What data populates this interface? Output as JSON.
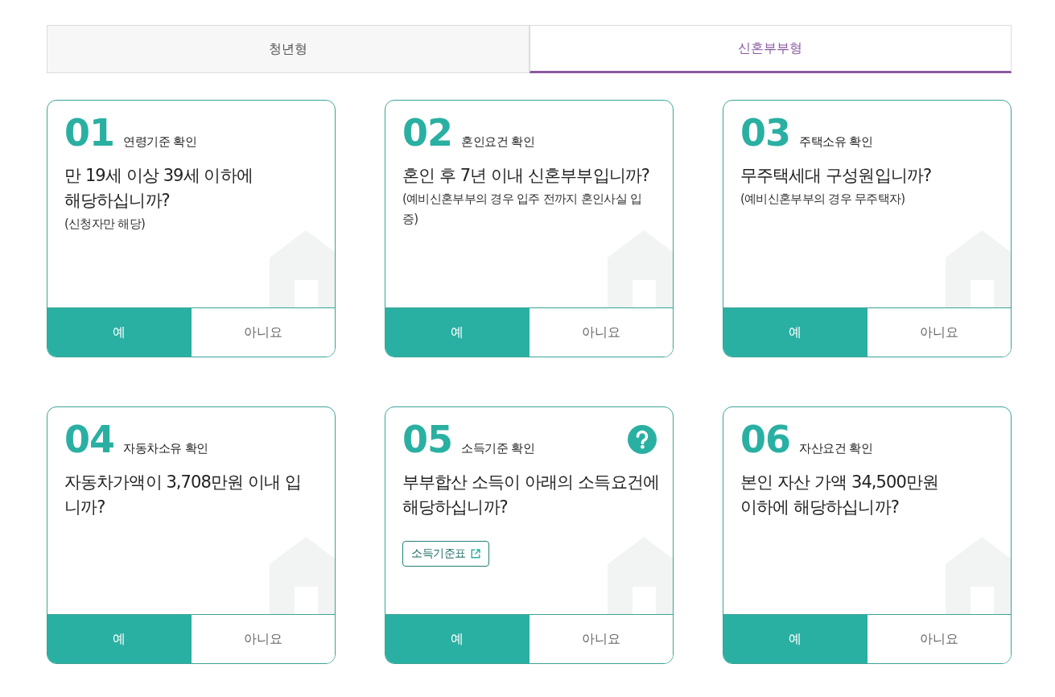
{
  "tabs": [
    {
      "label": "청년형",
      "selected": false
    },
    {
      "label": "신혼부부형",
      "selected": true
    }
  ],
  "cards": [
    {
      "number": "01",
      "title": "연령기준 확인",
      "question": "만 19세 이상 39세 이하에\n해당하십니까?",
      "note": "(신청자만 해당)",
      "answers": [
        {
          "label": "예",
          "selected": true
        },
        {
          "label": "아니요",
          "selected": false
        }
      ]
    },
    {
      "number": "02",
      "title": "혼인요건 확인",
      "question": "혼인 후 7년 이내 신혼부부입니까?",
      "note": "(예비신혼부부의 경우 입주 전까지 혼인사실 입\n증)",
      "answers": [
        {
          "label": "예",
          "selected": true
        },
        {
          "label": "아니요",
          "selected": false
        }
      ]
    },
    {
      "number": "03",
      "title": "주택소유 확인",
      "question": "무주택세대 구성원입니까?",
      "note": "(예비신혼부부의 경우 무주택자)",
      "answers": [
        {
          "label": "예",
          "selected": true
        },
        {
          "label": "아니요",
          "selected": false
        }
      ]
    },
    {
      "number": "04",
      "title": "자동차소유 확인",
      "question": "자동차가액이 3,708만원 이내 입\n니까?",
      "answers": [
        {
          "label": "예",
          "selected": true
        },
        {
          "label": "아니요",
          "selected": false
        }
      ]
    },
    {
      "number": "05",
      "title": "소득기준 확인",
      "help": true,
      "question": "부부합산 소득이 아래의 소득요건에\n해당하십니까?",
      "link": {
        "label": "소득기준표"
      },
      "answers": [
        {
          "label": "예",
          "selected": true
        },
        {
          "label": "아니요",
          "selected": false
        }
      ]
    },
    {
      "number": "06",
      "title": "자산요건 확인",
      "question": "본인 자산 가액 34,500만원\n이하에 해당하십니까?",
      "answers": [
        {
          "label": "예",
          "selected": true
        },
        {
          "label": "아니요",
          "selected": false
        }
      ]
    }
  ]
}
